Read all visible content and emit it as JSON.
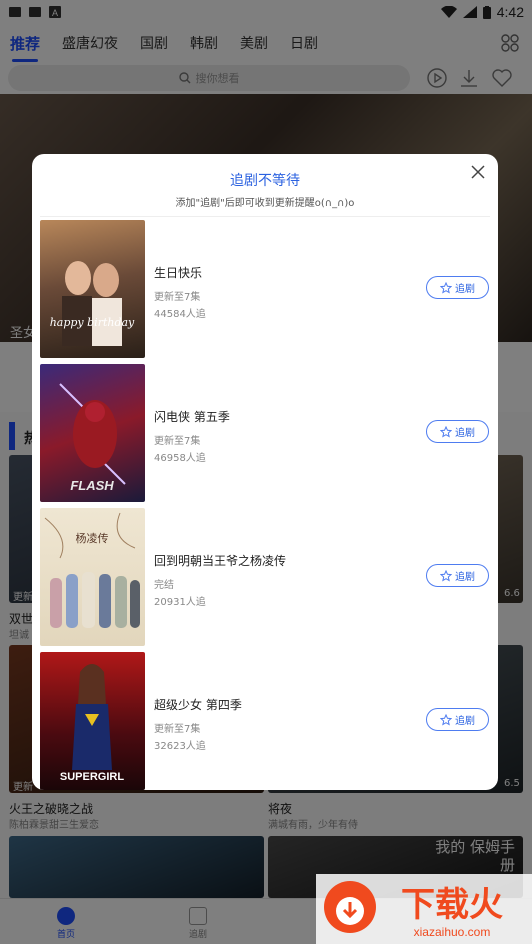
{
  "status_bar": {
    "time": "4:42"
  },
  "top_nav": {
    "tabs": [
      {
        "label": "推荐",
        "active": true
      },
      {
        "label": "盛唐幻夜",
        "active": false
      },
      {
        "label": "国剧",
        "active": false
      },
      {
        "label": "韩剧",
        "active": false
      },
      {
        "label": "美剧",
        "active": false
      },
      {
        "label": "日剧",
        "active": false
      }
    ]
  },
  "search": {
    "placeholder": "搜你想看"
  },
  "background": {
    "banner_caption": "圣女",
    "section_title": "热",
    "row1_left_title": "双世",
    "row1_left_sub": "坦诚",
    "row1_left_update": "更新",
    "row1_right_score": "6.6",
    "row2_left_title": "火王之破晓之战",
    "row2_left_sub": "陈柏霖景甜三生爱恋",
    "row2_left_update": "更新",
    "row2_right_title": "将夜",
    "row2_right_sub": "满城有雨，少年有侍",
    "row2_right_score": "6.5",
    "row3_right_poster_text": "我的 保姆手册",
    "bottom_nav": {
      "home": "首页",
      "follow": "追剧"
    }
  },
  "modal": {
    "title": "追剧不等待",
    "subtitle": "添加\"追剧\"后即可收到更新提醒o(∩_∩)o",
    "items": [
      {
        "name": "生日快乐",
        "episodes": "更新至7集",
        "followers": "44584人追",
        "button": "追剧",
        "poster_text": "happy birthday"
      },
      {
        "name": "闪电侠 第五季",
        "episodes": "更新至7集",
        "followers": "46958人追",
        "button": "追剧",
        "poster_text": "FLASH"
      },
      {
        "name": "回到明朝当王爷之杨凌传",
        "episodes": "完结",
        "followers": "20931人追",
        "button": "追剧",
        "poster_text": "杨凌传"
      },
      {
        "name": "超级少女 第四季",
        "episodes": "更新至7集",
        "followers": "32623人追",
        "button": "追剧",
        "poster_text": "SUPERGIRL"
      }
    ]
  },
  "watermark": {
    "brand": "下载火",
    "url": "xiazaihuo.com"
  },
  "colors": {
    "accent": "#1e4fff",
    "modal_title": "#2b62e0",
    "overlay": "rgba(0,0,0,0.5)"
  }
}
